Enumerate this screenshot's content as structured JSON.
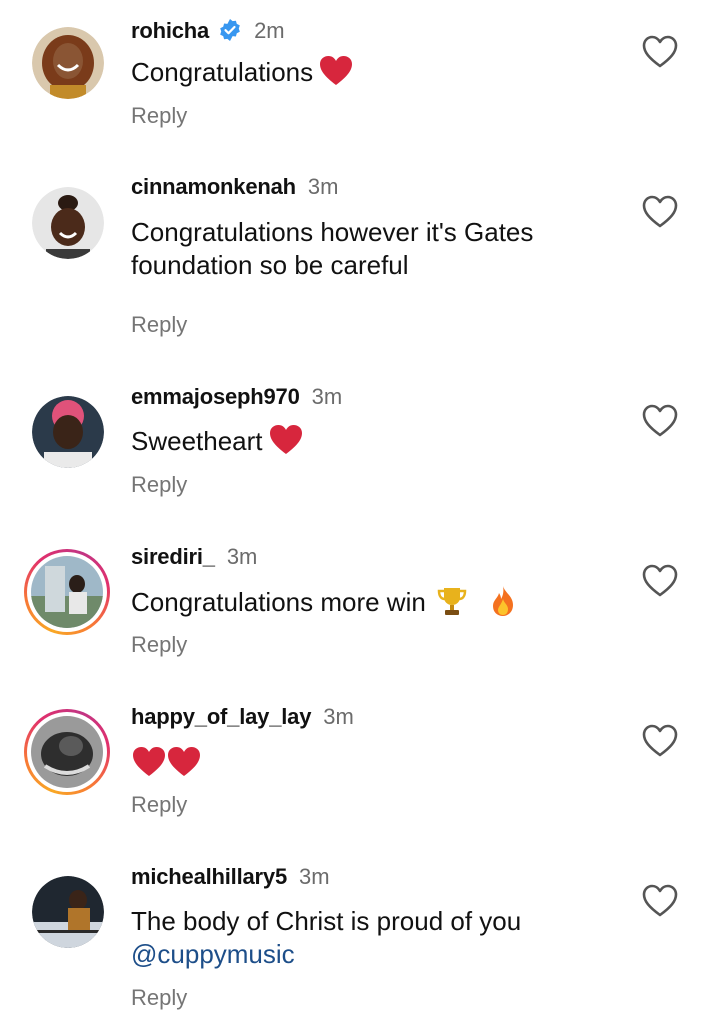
{
  "comments": [
    {
      "username": "rohicha",
      "verified": true,
      "time": "2m",
      "text": "Congratulations",
      "emoji": "red-heart",
      "reply": "Reply"
    },
    {
      "username": "cinnamonkenah",
      "verified": false,
      "time": "3m",
      "text": "Congratulations however it's Gates foundation so be careful",
      "reply": "Reply"
    },
    {
      "username": "emmajoseph970",
      "verified": false,
      "time": "3m",
      "text": "Sweetheart",
      "emoji": "red-heart",
      "reply": "Reply"
    },
    {
      "username": "sirediri_",
      "verified": false,
      "time": "3m",
      "text": "Congratulations more win",
      "emoji": "trophy, fire",
      "reply": "Reply",
      "story_ring": true
    },
    {
      "username": "happy_of_lay_lay",
      "verified": false,
      "time": "3m",
      "text": "",
      "emoji": "red-heart, red-heart",
      "reply": "Reply",
      "story_ring": true
    },
    {
      "username": "michealhillary5",
      "verified": false,
      "time": "3m",
      "text": "The body of Christ is proud of you",
      "mention": "@cuppymusic",
      "reply": "Reply"
    }
  ],
  "colors": {
    "mention": "#1d4e89",
    "verified": "#3897f0",
    "story_ring": "#e1306c",
    "heart": "#d7263d"
  }
}
